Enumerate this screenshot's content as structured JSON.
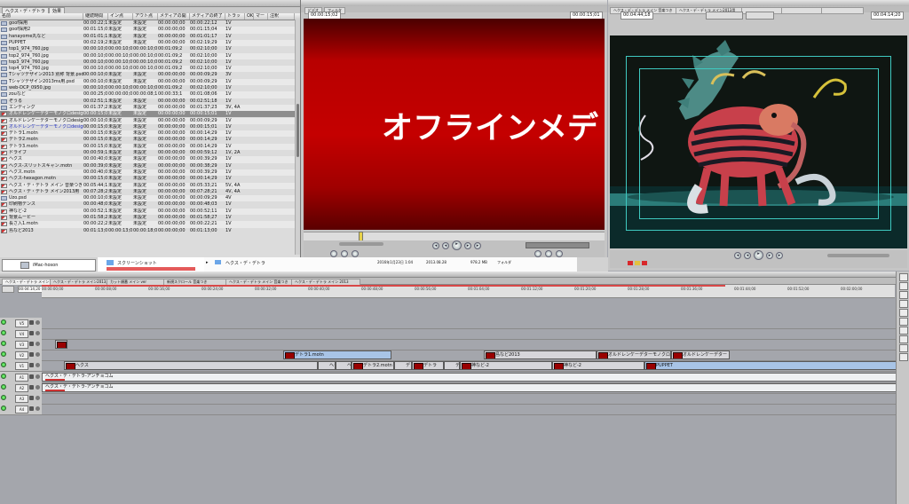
{
  "browser": {
    "title": "",
    "tabs": [
      "ヘクス・デ・デトラ",
      "効果"
    ],
    "columns": [
      "名前",
      "継続時間",
      "イン点",
      "アウト点",
      "メディアの開始",
      "メディアの終了",
      "トラック",
      "OK",
      "マーク",
      "注釈"
    ],
    "rows": [
      {
        "icon": "pic",
        "name": "goof採用",
        "dur": "00:00:22;1",
        "in": "未設定",
        "out": "未設定",
        "ms": "00:00:00;00",
        "me": "00:00:22;12",
        "tr": "1V"
      },
      {
        "icon": "pic",
        "name": "goof採用2",
        "dur": "00:01:15;0",
        "in": "未設定",
        "out": "未設定",
        "ms": "00:00:00;00",
        "me": "00:01:15;04",
        "tr": "1V"
      },
      {
        "icon": "pic",
        "name": "hanayome丸など",
        "dur": "00:01:01;1",
        "in": "未設定",
        "out": "未設定",
        "ms": "00:00:00;00",
        "me": "00:01:01;17",
        "tr": "1V"
      },
      {
        "icon": "pic",
        "name": "PUPPET",
        "dur": "00:02:19;2",
        "in": "未設定",
        "out": "未設定",
        "ms": "00:00:00;00",
        "me": "00:02:19;29",
        "tr": "1V"
      },
      {
        "icon": "pic",
        "name": "top1_974_760.jpg",
        "dur": "00:00:10;0",
        "in": "00:00:10;0",
        "out": "00:00:10;0",
        "ms": "00:01:09;2",
        "me": "00:02:10;00",
        "tr": "1V"
      },
      {
        "icon": "pic",
        "name": "top2_974_760.jpg",
        "dur": "00:00:10;0",
        "in": "00:00:10;0",
        "out": "00:00:10;0",
        "ms": "00:01:09;2",
        "me": "00:02:10;00",
        "tr": "1V"
      },
      {
        "icon": "pic",
        "name": "top3_974_760.jpg",
        "dur": "00:00:10;0",
        "in": "00:00:10;0",
        "out": "00:00:10;0",
        "ms": "00:01:09;2",
        "me": "00:02:10;00",
        "tr": "1V"
      },
      {
        "icon": "pic",
        "name": "top4_974_760.jpg",
        "dur": "00:00:10;0",
        "in": "00:00:10;0",
        "out": "00:00:10;0",
        "ms": "00:01:09;2",
        "me": "00:02:10;00",
        "tr": "1V"
      },
      {
        "icon": "pic",
        "name": "Tシャツデザイン2013 別称 背景.psd",
        "dur": "00:00:10;0",
        "in": "未設定",
        "out": "未設定",
        "ms": "00:00:00;00",
        "me": "00:00:09;29",
        "tr": "3V"
      },
      {
        "icon": "pic",
        "name": "Tシャツデザイン2013ms用.psd",
        "dur": "00:00:10;0",
        "in": "未設定",
        "out": "未設定",
        "ms": "00:00:00;00",
        "me": "00:00:09;29",
        "tr": "1V"
      },
      {
        "icon": "pic",
        "name": "web-DCP_0950.jpg",
        "dur": "00:00:10;0",
        "in": "00:00:10;0",
        "out": "00:00:10;0",
        "ms": "00:01:09;2",
        "me": "00:02:10;00",
        "tr": "1V"
      },
      {
        "icon": "pic",
        "name": "zouなど",
        "dur": "00:00:25;0",
        "in": "00:00:00;0",
        "out": "00:00:08;1",
        "ms": "00:00:33;1",
        "me": "00:01:08;06",
        "tr": "1V"
      },
      {
        "icon": "pic",
        "name": "ぞうる",
        "dur": "00:02:51;1",
        "in": "未設定",
        "out": "未設定",
        "ms": "00:00:00;00",
        "me": "00:02:51;18",
        "tr": "1V"
      },
      {
        "icon": "pic",
        "name": "エンディング",
        "dur": "00:01:37;2",
        "in": "未設定",
        "out": "未設定",
        "ms": "00:00:00;00",
        "me": "00:01:37;23",
        "tr": "3V, 4A"
      },
      {
        "icon": "seq",
        "name": "オルドレンケーデターモノクロdesign",
        "dur": "00:00:15;0",
        "in": "未設定",
        "out": "未設定",
        "ms": "00:00:00;00",
        "me": "00:00:15;01",
        "tr": "1V",
        "sel": true
      },
      {
        "icon": "seq",
        "name": "オルドレンケーデターモノクロdesign",
        "dur": "00:00:10;0",
        "in": "未設定",
        "out": "未設定",
        "ms": "00:00:00;00",
        "me": "00:00:09;29",
        "tr": "1V"
      },
      {
        "icon": "seq",
        "name": "オルドレンケーデターモノクロdesign",
        "dur": "00:00:15;0",
        "in": "未設定",
        "out": "未設定",
        "ms": "00:00:00;00",
        "me": "00:00:15;01",
        "tr": "1V",
        "hl": true
      },
      {
        "icon": "seq",
        "name": "デトラ1.motn",
        "dur": "00:00:15;0",
        "in": "未設定",
        "out": "未設定",
        "ms": "00:00:00;00",
        "me": "00:00:14;29",
        "tr": "1V"
      },
      {
        "icon": "seq",
        "name": "デトラ2.motn",
        "dur": "00:00:15;0",
        "in": "未設定",
        "out": "未設定",
        "ms": "00:00:00;00",
        "me": "00:00:14;29",
        "tr": "1V"
      },
      {
        "icon": "seq",
        "name": "デトラ3.motn",
        "dur": "00:00:15;0",
        "in": "未設定",
        "out": "未設定",
        "ms": "00:00:00;00",
        "me": "00:00:14;29",
        "tr": "1V"
      },
      {
        "icon": "seq",
        "name": "ドライブ",
        "dur": "00:00:59;1",
        "in": "未設定",
        "out": "未設定",
        "ms": "00:00:00;00",
        "me": "00:00:59;12",
        "tr": "1V, 2A"
      },
      {
        "icon": "seq",
        "name": "ヘクス",
        "dur": "00:00:40;0",
        "in": "未設定",
        "out": "未設定",
        "ms": "00:00:00;00",
        "me": "00:00:39;29",
        "tr": "1V"
      },
      {
        "icon": "seq",
        "name": "ヘクス-スリットスキャン.motn",
        "dur": "00:00:39;0",
        "in": "未設定",
        "out": "未設定",
        "ms": "00:00:00;00",
        "me": "00:00:38;29",
        "tr": "1V"
      },
      {
        "icon": "seq",
        "name": "ヘクス.motn",
        "dur": "00:00:40;0",
        "in": "未設定",
        "out": "未設定",
        "ms": "00:00:00;00",
        "me": "00:00:39;29",
        "tr": "1V"
      },
      {
        "icon": "seq",
        "name": "ヘクス-hexagon.motn",
        "dur": "00:00:15;0",
        "in": "未設定",
        "out": "未設定",
        "ms": "00:00:00;00",
        "me": "00:00:14;29",
        "tr": "1V"
      },
      {
        "icon": "seq",
        "name": "ヘクス・デ・デトラ メイン 音楽つき",
        "dur": "00:05:44;1",
        "in": "未設定",
        "out": "未設定",
        "ms": "00:00:00;00",
        "me": "00:05:33;21",
        "tr": "5V, 4A"
      },
      {
        "icon": "seq",
        "name": "ヘクス・デ・デトラ メイン2013用",
        "dur": "00:07:28;2",
        "in": "未設定",
        "out": "未設定",
        "ms": "00:00:00;00",
        "me": "00:07:28;21",
        "tr": "4V, 4A"
      },
      {
        "icon": "pic",
        "name": "Uzo.psd",
        "dur": "00:00:10;0",
        "in": "未設定",
        "out": "未設定",
        "ms": "00:00:00;00",
        "me": "00:00:09;29",
        "tr": "4V"
      },
      {
        "icon": "seq",
        "name": "印刷物デンス",
        "dur": "00:00:48;0",
        "in": "未設定",
        "out": "未設定",
        "ms": "00:00:00;00",
        "me": "00:00:48;03",
        "tr": "1V"
      },
      {
        "icon": "seq",
        "name": "神など-2",
        "dur": "00:00:52;1",
        "in": "未設定",
        "out": "未設定",
        "ms": "00:00:00;00",
        "me": "00:00:52;11",
        "tr": "1V"
      },
      {
        "icon": "seq",
        "name": "背景ムービー",
        "dur": "00:01:58;2",
        "in": "未設定",
        "out": "未設定",
        "ms": "00:00:00;00",
        "me": "00:01:58;27",
        "tr": "1V"
      },
      {
        "icon": "seq",
        "name": "長さ入1.motn",
        "dur": "00:00:22;2",
        "in": "未設定",
        "out": "未設定",
        "ms": "00:00:00;00",
        "me": "00:00:22;21",
        "tr": "1V"
      },
      {
        "icon": "seq",
        "name": "島など2013",
        "dur": "00:01:13;0",
        "in": "00:00:13;0",
        "out": "00:00:18;0",
        "ms": "00:00:00;00",
        "me": "00:01:13;00",
        "tr": "1V"
      }
    ]
  },
  "viewer": {
    "timecode_left": "00:00:15;02",
    "timecode_right": "00:00:15;01",
    "overlay_text": "オフラインメデ",
    "tabs": [
      "ビデオ",
      "フィルタ"
    ]
  },
  "canvas": {
    "title": "ヘクス・デ・デトラ メイン 音楽つき",
    "timecode_left": "00:04:44;18",
    "timecode_right": "00:04:14;20",
    "tabs": [
      "ヘクス・デ・デトラ メイン 音楽つき",
      "ヘクス・デ・デトラ メイン2013用"
    ]
  },
  "strip": {
    "computer": "iMac-hoson",
    "folder": "スクリーンショット",
    "path_item": "ヘクス・デ・デトラ",
    "date": "2016年1月23日 1:04",
    "modified": "2013.08.28",
    "size": "978.2 MB",
    "kind": "フォルダ"
  },
  "timeline": {
    "tabs": [
      "ヘクス・デ・デトラ メイン 音楽つき",
      "ヘクス・デ・デトラ メイン2013用",
      "カット順番 メイン ver",
      "新規スクロール 音楽つき",
      "ヘクス・デ・デトラ メイン 音楽つき",
      "ヘクス・デ・デトラ メイン 2013"
    ],
    "timecode": "00:04:14;20",
    "ruler": [
      "00:00:00;00",
      "00:00:08;00",
      "00:00:16;00",
      "00:00:24;00",
      "00:00:32;00",
      "00:00:40;00",
      "00:00:48;00",
      "00:00:56;00",
      "00:01:04;00",
      "00:01:12;00",
      "00:01:20;00",
      "00:01:28;00",
      "00:01:36;00",
      "00:01:44;00",
      "00:01:52;00",
      "00:02:00;00"
    ],
    "tracks": [
      "V5",
      "V4",
      "V3",
      "V2",
      "V1",
      "A1",
      "A2",
      "A3",
      "A4"
    ],
    "clips": {
      "v2": [
        "デトラ1.motn",
        "島など2013",
        "オルドレンケーデターモノクロ",
        "オルドレンケーデター"
      ],
      "v1": [
        "ヘクス",
        "ヘクス",
        "ヘクス",
        "デトラ2.motn",
        "デトラ",
        "デトラ",
        "デトラ3",
        "神など-2",
        "神など-2",
        "PUPPET"
      ],
      "a1": "ヘクス・デ・デトラ-アンチョコム",
      "a2": "ヘクス・デ・デトラ-アンチョコム"
    }
  }
}
